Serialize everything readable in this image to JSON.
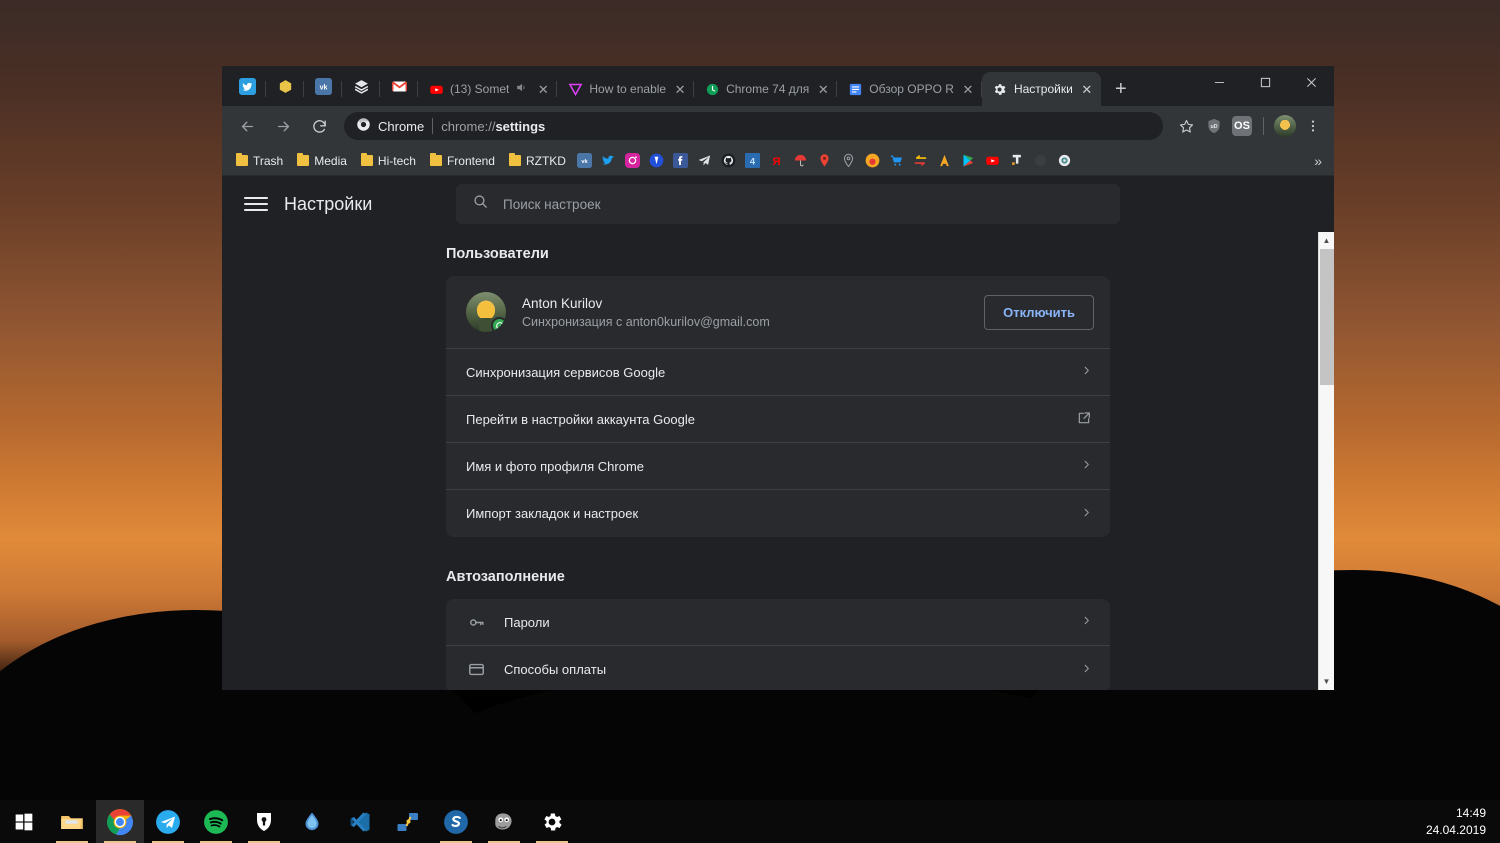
{
  "window": {
    "controls": {
      "minimize": "—",
      "maximize": "□",
      "close": "✕"
    }
  },
  "tabstrip": {
    "pinned": [
      {
        "name": "twitter",
        "icon": "twitter-icon"
      },
      {
        "name": "hexagon",
        "icon": "hexagon-icon"
      },
      {
        "name": "vk",
        "icon": "vk-icon"
      },
      {
        "name": "layers",
        "icon": "layers-icon"
      },
      {
        "name": "gmail",
        "icon": "gmail-icon"
      }
    ],
    "tabs": [
      {
        "title": "(13) Somet",
        "icon": "youtube-icon",
        "audio": true,
        "active": false
      },
      {
        "title": "How to enable",
        "icon": "vimeo-triangle-icon",
        "audio": false,
        "active": false
      },
      {
        "title": "Chrome 74 для",
        "icon": "clock-green-icon",
        "audio": false,
        "active": false
      },
      {
        "title": "Обзор OPPO R",
        "icon": "document-blue-icon",
        "audio": false,
        "active": false
      },
      {
        "title": "Настройки",
        "icon": "gear-icon",
        "audio": false,
        "active": true
      }
    ],
    "close_label": "✕",
    "new_tab_label": "+"
  },
  "toolbar": {
    "back_label": "←",
    "forward_label": "→",
    "reload_label": "⟳",
    "omnibox": {
      "chip_label": "Chrome",
      "url_prefix": "chrome://",
      "url_bold": "settings"
    },
    "bookmark_star": "☆",
    "extensions": [
      {
        "name": "ublock-origin-extension",
        "label": "uD"
      },
      {
        "name": "os-extension",
        "label": "OS"
      }
    ],
    "menu_label": "⋮"
  },
  "bookmarks_bar": {
    "folders": [
      "Trash",
      "Media",
      "Hi-tech",
      "Frontend",
      "RZTKD"
    ],
    "icons": [
      "vk-icon",
      "twitter-icon",
      "instagram-icon",
      "viber-icon",
      "facebook-icon",
      "telegram-icon",
      "github-icon",
      "channel4-icon",
      "yandex-icon",
      "umbrella-icon",
      "maps-pin-red-icon",
      "maps-pin-gray-icon",
      "mts-icon",
      "cart-icon",
      "swap-arrows-icon",
      "autodesk-icon",
      "google-play-icon",
      "youtube-icon",
      "jt-icon",
      "dark-circle-icon",
      "target-icon"
    ],
    "overflow_label": "»"
  },
  "settings": {
    "menu_label": "Меню",
    "title": "Настройки",
    "search": {
      "placeholder": "Поиск настроек",
      "value": "",
      "icon": "search-icon"
    },
    "sections": [
      {
        "title": "Пользователи",
        "profile": {
          "name": "Anton Kurilov",
          "sync_status": "Синхронизация с anton0kurilov@gmail.com",
          "button": "Отключить",
          "avatar_name": "user-avatar",
          "badge_icon": "sync-badge-icon"
        },
        "rows": [
          {
            "label": "Синхронизация сервисов Google",
            "trailing": "chevron-right-icon",
            "icon": null
          },
          {
            "label": "Перейти в настройки аккаунта Google",
            "trailing": "external-link-icon",
            "icon": null
          },
          {
            "label": "Имя и фото профиля Chrome",
            "trailing": "chevron-right-icon",
            "icon": null
          },
          {
            "label": "Импорт закладок и настроек",
            "trailing": "chevron-right-icon",
            "icon": null
          }
        ]
      },
      {
        "title": "Автозаполнение",
        "rows": [
          {
            "label": "Пароли",
            "trailing": "chevron-right-icon",
            "icon": "key-icon"
          },
          {
            "label": "Способы оплаты",
            "trailing": "chevron-right-icon",
            "icon": "credit-card-icon"
          }
        ]
      }
    ],
    "scrollbar": {
      "up": "▲",
      "down": "▼"
    }
  },
  "taskbar": {
    "start_icon": "windows-start-icon",
    "items": [
      {
        "name": "file-explorer",
        "icon": "folder-icon",
        "active": false,
        "running": true
      },
      {
        "name": "google-chrome",
        "icon": "chrome-icon",
        "active": true,
        "running": true
      },
      {
        "name": "telegram",
        "icon": "telegram-icon",
        "active": false,
        "running": true
      },
      {
        "name": "spotify",
        "icon": "spotify-icon",
        "active": false,
        "running": true
      },
      {
        "name": "keepass",
        "icon": "keepass-icon",
        "active": false,
        "running": true
      },
      {
        "name": "rainmeter",
        "icon": "water-drop-icon",
        "active": false,
        "running": false
      },
      {
        "name": "visual-studio-code",
        "icon": "vscode-icon",
        "active": false,
        "running": false
      },
      {
        "name": "network-tool",
        "icon": "network-icon",
        "active": false,
        "running": false
      },
      {
        "name": "sublime-merge",
        "icon": "s-circle-icon",
        "active": false,
        "running": true
      },
      {
        "name": "gimp",
        "icon": "gimp-icon",
        "active": false,
        "running": true
      },
      {
        "name": "settings",
        "icon": "gear-icon",
        "active": false,
        "running": true
      }
    ],
    "clock": {
      "time": "14:49",
      "date": "24.04.2019"
    }
  }
}
